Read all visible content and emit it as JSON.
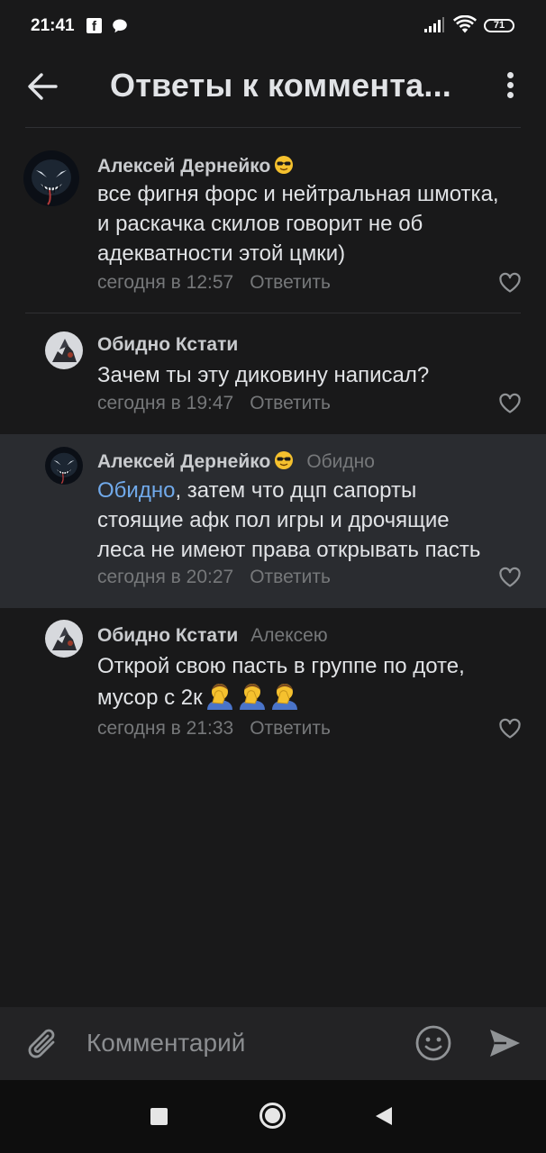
{
  "status_bar": {
    "time": "21:41",
    "battery": "71",
    "fb_icon": "facebook-icon",
    "chat_icon": "chat-bubble-icon"
  },
  "header": {
    "title": "Ответы к коммента..."
  },
  "comments": [
    {
      "author": "Алексей Дернейко",
      "author_emoji": "smiling-face-with-sunglasses",
      "reply_to": "",
      "mention": "",
      "lines": [
        "все фигня форс и нейтральная шмотка,",
        "и раскачка скилов говорит не об",
        "адекватности этой цмки)"
      ],
      "time": "сегодня в 12:57",
      "reply_label": "Ответить"
    },
    {
      "author": "Обидно Кстати",
      "reply_to": "",
      "mention": "",
      "lines": [
        "Зачем ты эту диковину написал?"
      ],
      "time": "сегодня в 19:47",
      "reply_label": "Ответить"
    },
    {
      "author": "Алексей Дернейко",
      "author_emoji": "smiling-face-with-sunglasses",
      "reply_to": "Обидно",
      "mention": "Обидно",
      "lines": [
        ", затем что дцп сапорты",
        "стоящие афк пол игры и дрочящие",
        "леса не имеют права открывать пасть"
      ],
      "time": "сегодня в 20:27",
      "reply_label": "Ответить",
      "highlighted": true
    },
    {
      "author": "Обидно Кстати",
      "reply_to": "Алексею",
      "mention": "",
      "lines": [
        "Открой свою пасть в группе по доте,",
        "мусор с 2к"
      ],
      "trailing_emoji": [
        "facepalm",
        "facepalm",
        "facepalm"
      ],
      "time": "сегодня в 21:33",
      "reply_label": "Ответить"
    }
  ],
  "composer": {
    "placeholder": "Комментарий",
    "attach_icon": "paperclip-icon",
    "emoji_icon": "smiley-icon",
    "send_icon": "send-icon"
  },
  "colors": {
    "background": "#19191a",
    "highlight": "#2a2c30",
    "mention": "#71aaeb",
    "secondary_text": "#76787a",
    "primary_text": "#e1e3e6"
  }
}
